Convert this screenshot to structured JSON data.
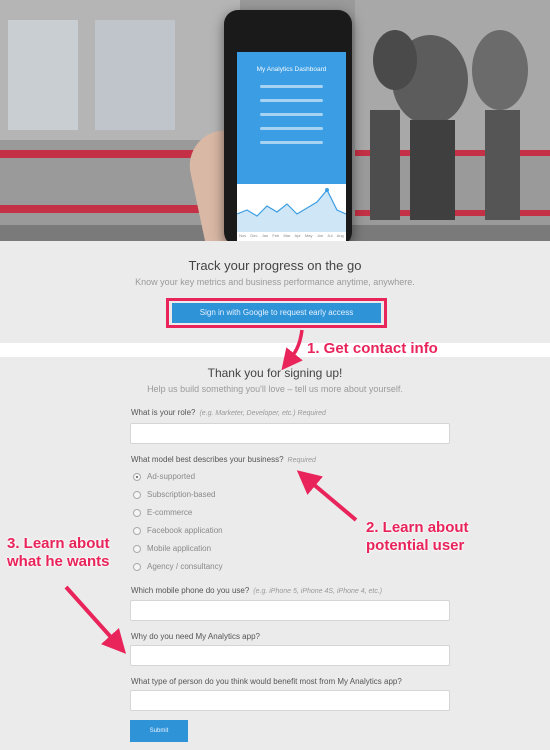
{
  "hero": {
    "phone_app_title": "My Analytics Dashboard",
    "chart_months": [
      "Nov",
      "Dec",
      "Jan",
      "Feb",
      "Mar",
      "Apr",
      "May",
      "Jun",
      "Jul",
      "Aug"
    ]
  },
  "intro": {
    "title": "Track your progress on the go",
    "subtitle": "Know your key metrics and business performance anytime, anywhere.",
    "google_button_label": "Sign in with Google to request early access"
  },
  "form": {
    "title": "Thank you for signing up!",
    "subtitle": "Help us build something you'll love – tell us more about yourself.",
    "role_label": "What is your role?",
    "role_hint": "(e.g. Marketer, Developer, etc.)  Required",
    "model_label": "What model best describes your business?",
    "model_hint": "Required",
    "model_options": [
      "Ad-supported",
      "Subscription-based",
      "E-commerce",
      "Facebook application",
      "Mobile application",
      "Agency / consultancy"
    ],
    "model_selected": "Ad-supported",
    "phone_label": "Which mobile phone do you use?",
    "phone_hint": "(e.g. iPhone 5, iPhone 4S, iPhone 4, etc.)",
    "need_label": "Why do you need My Analytics app?",
    "who_label": "What type of person do you think would benefit most from My Analytics app?",
    "submit_label": "Submit"
  },
  "annotations": {
    "step1": "1. Get contact info",
    "step2_line1": "2. Learn about",
    "step2_line2": "potential user",
    "step3_line1": "3. Learn about",
    "step3_line2": "what he wants"
  },
  "colors": {
    "accent_blue": "#2f93d8",
    "annotation_pink": "#e8245b",
    "background": "#ebebeb"
  }
}
